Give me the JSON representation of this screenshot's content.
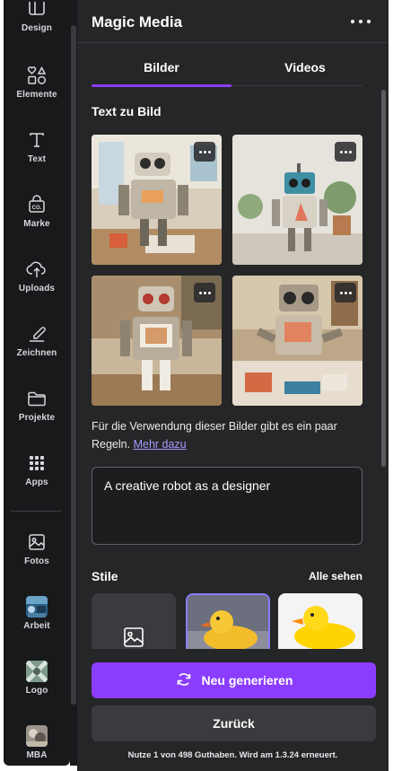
{
  "sidebar": {
    "items": [
      {
        "label": "Design",
        "icon": "design-icon"
      },
      {
        "label": "Elemente",
        "icon": "elements-icon"
      },
      {
        "label": "Text",
        "icon": "text-icon"
      },
      {
        "label": "Marke",
        "icon": "brand-icon"
      },
      {
        "label": "Uploads",
        "icon": "upload-cloud-icon"
      },
      {
        "label": "Zeichnen",
        "icon": "draw-icon"
      },
      {
        "label": "Projekte",
        "icon": "folder-icon"
      },
      {
        "label": "Apps",
        "icon": "apps-grid-icon"
      },
      {
        "label": "Fotos",
        "icon": "photo-icon"
      },
      {
        "label": "Arbeit",
        "icon": "arbeit-thumbnail"
      },
      {
        "label": "Logo",
        "icon": "logo-thumbnail"
      },
      {
        "label": "MBA",
        "icon": "mba-thumbnail"
      }
    ]
  },
  "panel": {
    "title": "Magic Media",
    "tabs": [
      {
        "label": "Bilder",
        "active": true
      },
      {
        "label": "Videos",
        "active": false
      }
    ],
    "section_title": "Text zu Bild",
    "note_text": "Für die Verwendung dieser Bilder gibt es ein paar Regeln.",
    "note_link": "Mehr dazu",
    "prompt_value": "A creative robot as a designer",
    "styles_title": "Stile",
    "styles_see_all": "Alle sehen",
    "generate_label": "Neu generieren",
    "back_label": "Zurück",
    "credits_text": "Nutze 1 von 498 Guthaben. Wird am 1.3.24 erneuert."
  },
  "colors": {
    "accent": "#8b3dff",
    "panel_bg": "#252627",
    "rail_bg": "#18191b",
    "link": "#a79bff"
  }
}
